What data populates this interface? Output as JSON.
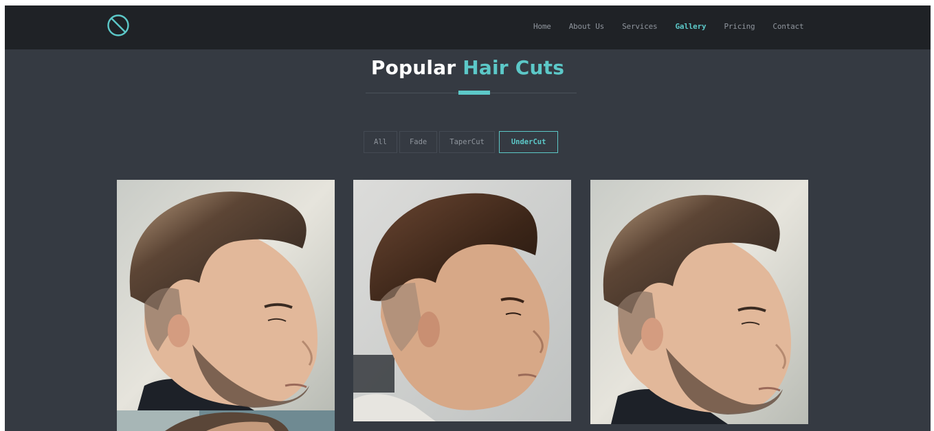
{
  "nav": {
    "logo_icon": "circle-slash-icon",
    "links": [
      {
        "label": "Home",
        "active": false
      },
      {
        "label": "About Us",
        "active": false
      },
      {
        "label": "Services",
        "active": false
      },
      {
        "label": "Gallery",
        "active": true
      },
      {
        "label": "Pricing",
        "active": false
      },
      {
        "label": "Contact",
        "active": false
      }
    ]
  },
  "section": {
    "title_main": "Popular",
    "title_accent": "Hair Cuts"
  },
  "filters": [
    {
      "label": "All",
      "active": false
    },
    {
      "label": "Fade",
      "active": false
    },
    {
      "label": "TaperCut",
      "active": false
    },
    {
      "label": "UnderCut",
      "active": true
    }
  ],
  "colors": {
    "accent": "#5cc8c8",
    "background": "#353a42",
    "navbar": "#1f2226"
  },
  "gallery": [
    {
      "image": "man-profile-undercut-photo-1"
    },
    {
      "image": "man-profile-undercut-photo-2"
    },
    {
      "image": "man-profile-undercut-photo-3"
    },
    {
      "image": "man-profile-undercut-photo-4"
    }
  ]
}
